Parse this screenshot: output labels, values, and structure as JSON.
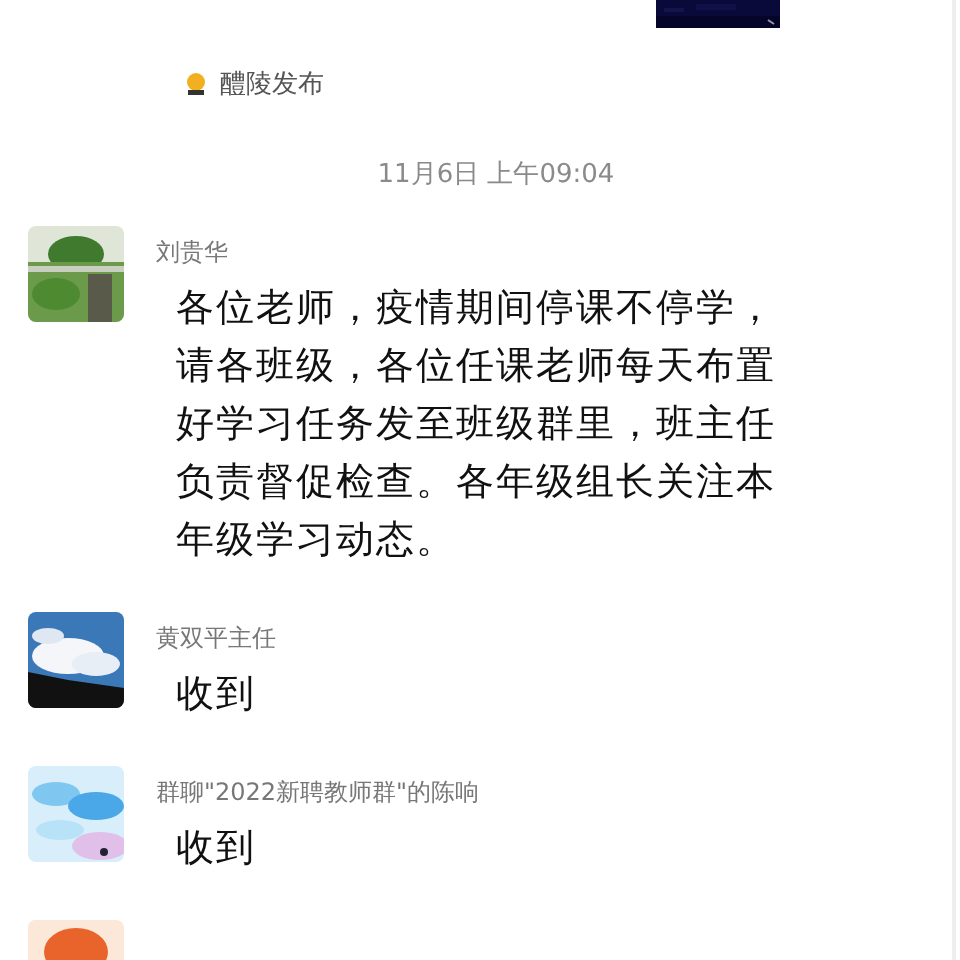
{
  "shared_image": {
    "kind": "picture"
  },
  "source": {
    "label": "醴陵发布"
  },
  "timestamp": "11月6日 上午09:04",
  "messages": [
    {
      "sender": "刘贵华",
      "text": "各位老师，疫情期间停课不停学，请各班级，各位任课老师每天布置好学习任务发至班级群里，班主任负责督促检查。各年级组长关注本年级学习动态。",
      "avatar": {
        "kind": "picture"
      }
    },
    {
      "sender": "黄双平主任",
      "text": "收到",
      "avatar": {
        "kind": "picture"
      }
    },
    {
      "sender": "群聊\"2022新聘教师群\"的陈响",
      "text": "收到",
      "avatar": {
        "kind": "picture"
      }
    },
    {
      "avatar": {
        "kind": "picture"
      }
    }
  ]
}
